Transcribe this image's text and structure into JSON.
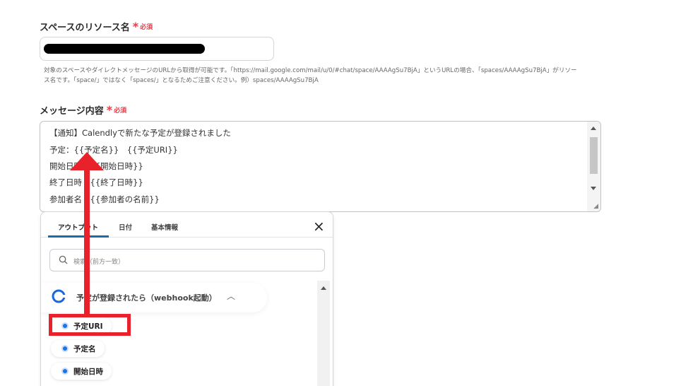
{
  "resource_field": {
    "label": "スペースのリソース名",
    "required_star": "*",
    "required_text": "必須",
    "hint_line1": "対象のスペースやダイレクトメッセージのURLから取得が可能です。「https://mail.google.com/mail/u/0/#chat/space/AAAAgSu7BjA」というURLの場合、「spaces/AAAAgSu7BjA」がリソー",
    "hint_line2": "ス名です。「space/」ではなく「spaces/」となるためご注意ください。例）spaces/AAAAgSu7BjA"
  },
  "message_field": {
    "label": "メッセージ内容",
    "required_star": "*",
    "required_text": "必須",
    "lines": [
      "【通知】Calendlyで新たな予定が登録されました",
      "予定：{{予定名}}　{{予定URI}}",
      "開始日時　{{開始日時}}",
      "終了日時　{{終了日時}}",
      "参加者名　{{参加者の名前}}"
    ]
  },
  "popup": {
    "tabs": [
      "アウトプット",
      "日付",
      "基本情報"
    ],
    "active_tab": "アウトプット",
    "close_label": "×",
    "search_placeholder": "検索（前方一致）",
    "group_label": "予定が登録されたら（webhook起動）",
    "items": [
      "予定URI",
      "予定名",
      "開始日時"
    ]
  },
  "colors": {
    "required": "#e23d4a",
    "accent_tab": "#1a6ea8",
    "radio": "#1a73e8",
    "annotation": "#e8212b"
  },
  "icons": {
    "search": "search-icon",
    "close": "close-icon",
    "group": "calendly-icon",
    "chevron": "chevron-up-icon"
  }
}
